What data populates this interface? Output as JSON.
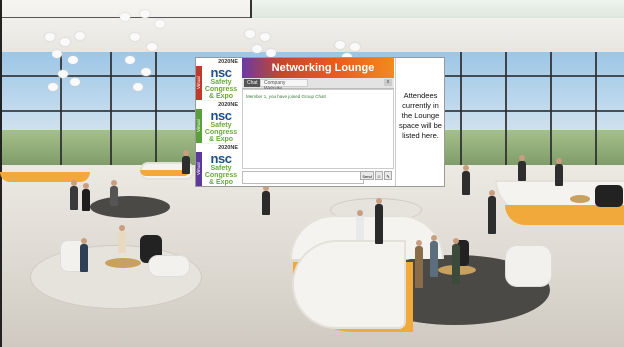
{
  "chat_window": {
    "title": "Networking Lounge",
    "tabs": [
      {
        "label": "Chat"
      },
      {
        "label": "Company Website"
      }
    ],
    "close_label": "x",
    "messages": [
      {
        "text": "Member 1, you have joined Group Chat!"
      }
    ],
    "input": {
      "value": "",
      "placeholder": ""
    },
    "send_label": "Send",
    "tool_buttons": [
      "☺",
      "✎"
    ],
    "attendees_note": "Attendees currently in the Lounge space will be listed here."
  },
  "sponsor_ads": [
    {
      "zone": "2020NE",
      "logo": "nsc",
      "line1": "Safety",
      "line2": "Congress",
      "line3": "& Expo",
      "side": "Virtual"
    },
    {
      "zone": "2020NE",
      "logo": "nsc",
      "line1": "Safety",
      "line2": "Congress",
      "line3": "& Expo",
      "side": "Virtual"
    },
    {
      "zone": "2020NE",
      "logo": "nsc",
      "line1": "Safety",
      "line2": "Congress",
      "line3": "& Expo",
      "side": "Virtual"
    }
  ],
  "colors": {
    "title_gradient_start": "#6b3aa3",
    "title_gradient_end": "#f28a1f",
    "nsc_blue": "#1b4f8e",
    "expo_green": "#6aa83a",
    "sofa_orange": "#f2a93b",
    "ad_stripes": [
      "#c0392b",
      "#5aa03a",
      "#5b3a9a"
    ]
  },
  "icons": {
    "close": "close-icon",
    "emoji": "emoji-icon",
    "edit": "edit-icon"
  }
}
